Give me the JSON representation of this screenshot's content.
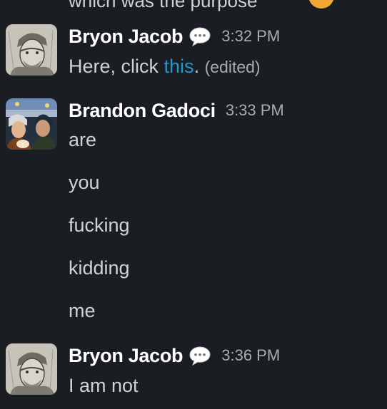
{
  "previous_message": {
    "fragment": "which was the purpose"
  },
  "messages": [
    {
      "author": "Bryon Jacob",
      "status_icon": "speech-balloon-icon",
      "time": "3:32 PM",
      "text_before_link": "Here, click ",
      "link_text": "this",
      "text_after_link": ".",
      "edited_label": "(edited)"
    },
    {
      "author": "Brandon Gadoci",
      "time": "3:33 PM",
      "lines": [
        "are",
        "you",
        "fucking",
        "kidding",
        "me"
      ]
    },
    {
      "author": "Bryon Jacob",
      "status_icon": "speech-balloon-icon",
      "time": "3:36 PM",
      "text": "I am not"
    }
  ],
  "colors": {
    "background": "#1a1d21",
    "author": "#ffffff",
    "text": "#d1d2d3",
    "timestamp": "#ababad",
    "link": "#1d9bd1"
  }
}
